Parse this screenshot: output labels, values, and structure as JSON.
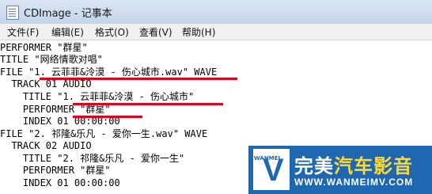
{
  "window": {
    "title": "CDImage - 记事本"
  },
  "menu": [
    {
      "label": "文件(F)"
    },
    {
      "label": "编辑(E)"
    },
    {
      "label": "格式(O)"
    },
    {
      "label": "查看(V)"
    },
    {
      "label": "帮助(H)"
    }
  ],
  "document": {
    "lines": [
      "PERFORMER \"群星\"",
      "TITLE \"网络情歌对唱\"",
      "FILE \"1. 云菲菲&泠漠 - 伤心城市.wav\" WAVE",
      "  TRACK 01 AUDIO",
      "    TITLE \"1. 云菲菲&泠漠 - 伤心城市\"",
      "    PERFORMER \"群星\"",
      "    INDEX 01 00:00:00",
      "FILE \"2. 祁隆&乐凡 - 爱你一生.wav\" WAVE",
      "  TRACK 02 AUDIO",
      "    TITLE \"2. 祁隆&乐凡 - 爱你一生\"",
      "    PERFORMER \"群星\"",
      "    INDEX 01 00:00:00"
    ]
  },
  "colors": {
    "underline": "#e3001b",
    "logo_bg": "#1f67b1",
    "logo_accent": "#ffda33"
  },
  "watermark": {
    "badge_text": "WANMEI",
    "name_main": "完美",
    "name_accent": "汽车影音",
    "url": "WWW.WANMEIMV.COM"
  }
}
